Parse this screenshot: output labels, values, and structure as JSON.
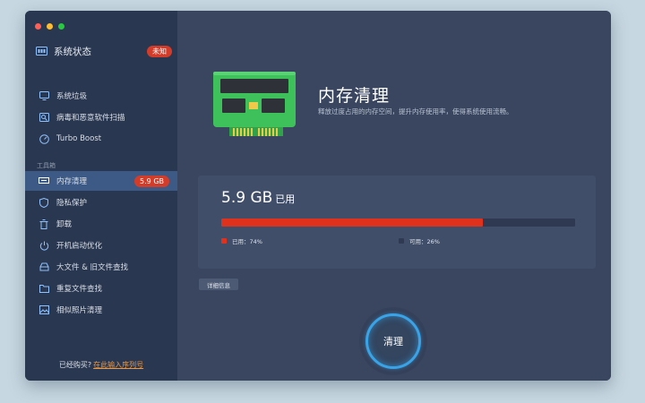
{
  "sidebar": {
    "system_status": {
      "label": "系统状态",
      "badge": "未知"
    },
    "items": [
      {
        "label": "系统垃圾",
        "icon": "monitor-icon"
      },
      {
        "label": "病毒和恶意软件扫描",
        "icon": "scan-icon"
      },
      {
        "label": "Turbo Boost",
        "icon": "speedometer-icon"
      }
    ],
    "section_title": "工具箱",
    "tools": [
      {
        "label": "内存清理",
        "icon": "memory-icon",
        "badge": "5.9 GB",
        "active": true
      },
      {
        "label": "隐私保护",
        "icon": "shield-icon"
      },
      {
        "label": "卸载",
        "icon": "trash-icon"
      },
      {
        "label": "开机启动优化",
        "icon": "power-icon"
      },
      {
        "label": "大文件 & 旧文件查找",
        "icon": "drive-icon"
      },
      {
        "label": "重复文件查找",
        "icon": "folder-icon"
      },
      {
        "label": "相似照片清理",
        "icon": "photo-icon"
      }
    ],
    "purchase": {
      "text": "已经购买?",
      "link": "在此输入序列号"
    }
  },
  "main": {
    "title": "内存清理",
    "subtitle": "释放过度占用的内存空间，提升内存使用率，使得系统使用流畅。",
    "memory": {
      "used_value": "5.9 GB",
      "used_unit": "已用",
      "used_fraction": 0.74,
      "used_label": "已用：74%",
      "free_label": "可用：26%"
    },
    "detail_button": "详细信息",
    "clean_button": "清理"
  },
  "colors": {
    "accent": "#39a3e8",
    "used": "#e0311c",
    "badge": "#d43c2a",
    "link": "#f0963a",
    "chip_green": "#3ec05a"
  }
}
